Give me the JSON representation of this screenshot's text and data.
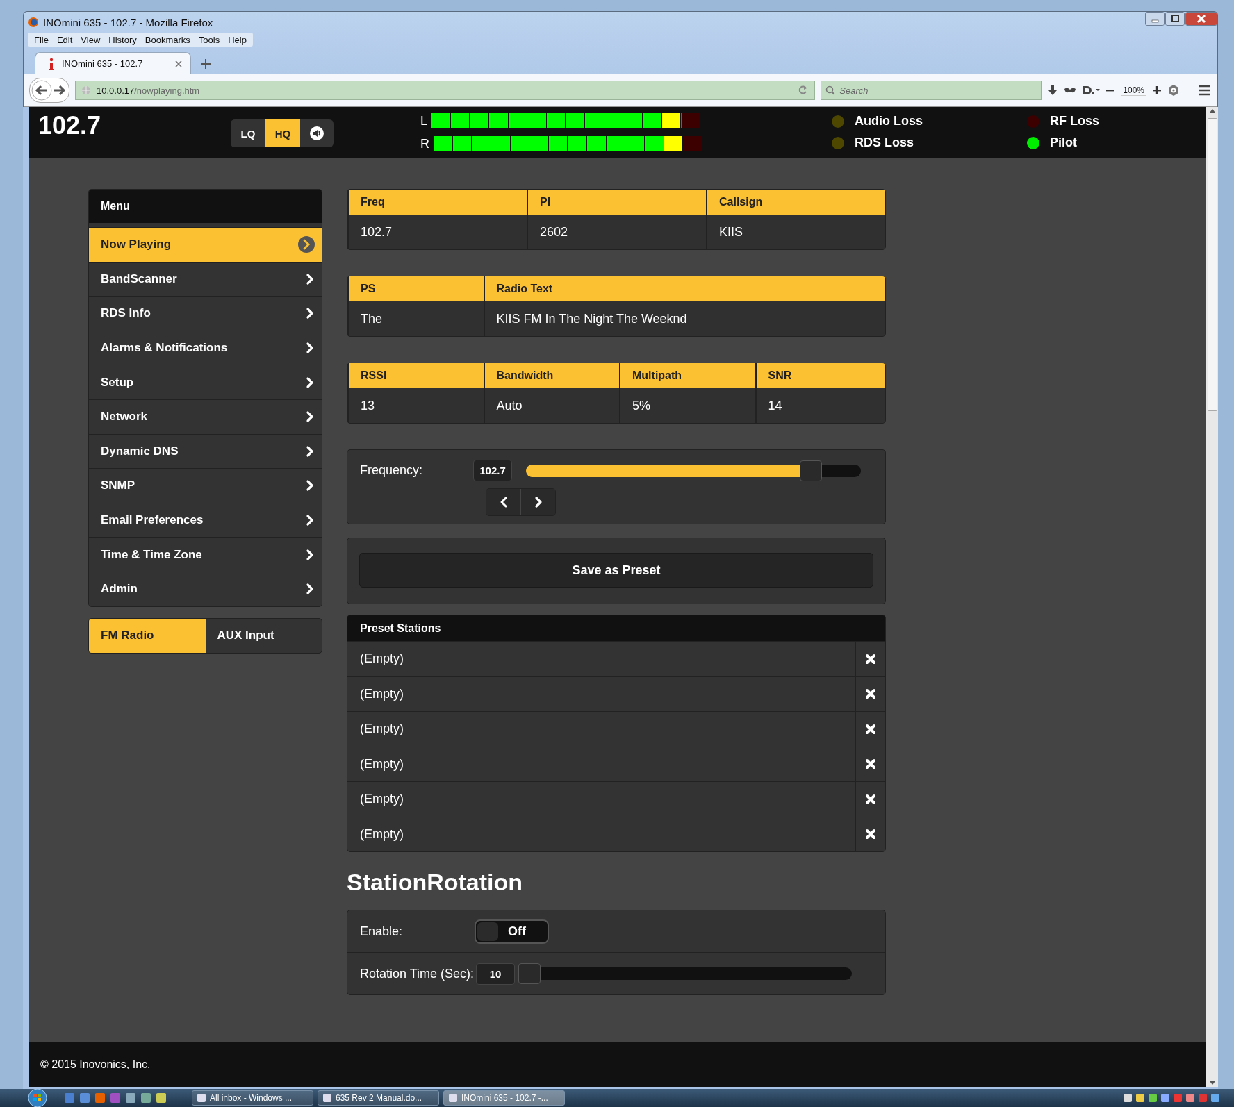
{
  "browser": {
    "title": "INOmini 635 - 102.7 - Mozilla Firefox",
    "menu": [
      "File",
      "Edit",
      "View",
      "History",
      "Bookmarks",
      "Tools",
      "Help"
    ],
    "tab": "INOmini 635 - 102.7",
    "url_host": "10.0.0.17",
    "url_path": "/nowplaying.htm",
    "search": {
      "placeholder": "Search"
    },
    "zoom": "100%"
  },
  "header": {
    "frequency": "102.7",
    "quality": [
      {
        "label": "LQ",
        "selected": false
      },
      {
        "label": "HQ",
        "selected": true
      }
    ],
    "meters": [
      {
        "label": "L",
        "level": 0.929
      },
      {
        "label": "R",
        "level": 0.929
      }
    ],
    "indicators": [
      {
        "label": "Audio Loss",
        "color": "#4d4700"
      },
      {
        "label": "RF Loss",
        "color": "#3d0000"
      },
      {
        "label": "RDS Loss",
        "color": "#4d4700"
      },
      {
        "label": "Pilot",
        "color": "#00ee00"
      }
    ]
  },
  "sidebar": {
    "title": "Menu",
    "items": [
      {
        "label": "Now Playing",
        "selected": true
      },
      {
        "label": "BandScanner",
        "selected": false
      },
      {
        "label": "RDS Info",
        "selected": false
      },
      {
        "label": "Alarms & Notifications",
        "selected": false
      },
      {
        "label": "Setup",
        "selected": false
      },
      {
        "label": "Network",
        "selected": false
      },
      {
        "label": "Dynamic DNS",
        "selected": false
      },
      {
        "label": "SNMP",
        "selected": false
      },
      {
        "label": "Email Preferences",
        "selected": false
      },
      {
        "label": "Time & Time Zone",
        "selected": false
      },
      {
        "label": "Admin",
        "selected": false
      }
    ],
    "sources": [
      {
        "label": "FM Radio",
        "selected": true
      },
      {
        "label": "AUX Input",
        "selected": false
      }
    ]
  },
  "info_panels": [
    [
      {
        "label": "Freq",
        "value": "102.7"
      },
      {
        "label": "PI",
        "value": "2602"
      },
      {
        "label": "Callsign",
        "value": "KIIS"
      }
    ],
    [
      {
        "label": "PS",
        "value": "The"
      },
      {
        "label": "Radio Text",
        "value": "KIIS FM In The Night The Weeknd"
      }
    ],
    [
      {
        "label": "RSSI",
        "value": "13"
      },
      {
        "label": "Bandwidth",
        "value": "Auto"
      },
      {
        "label": "Multipath",
        "value": "5%"
      },
      {
        "label": "SNR",
        "value": "14"
      }
    ]
  ],
  "frequency": {
    "label": "Frequency:",
    "value": "102.7",
    "level": 0.875
  },
  "save_button": "Save as Preset",
  "presets": {
    "title": "Preset Stations",
    "items": [
      "(Empty)",
      "(Empty)",
      "(Empty)",
      "(Empty)",
      "(Empty)",
      "(Empty)"
    ]
  },
  "rotation": {
    "heading": "StationRotation",
    "enable_label": "Enable:",
    "toggle": {
      "label": "Off",
      "on": false
    },
    "time_label": "Rotation Time (Sec):",
    "time_value": "10",
    "level": 0
  },
  "footer": "© 2015 Inovonics, Inc.",
  "taskbar": [
    {
      "label": "All inbox - Windows ...",
      "selected": false
    },
    {
      "label": "635 Rev 2 Manual.do...",
      "selected": false
    },
    {
      "label": "INOmini 635 - 102.7 -...",
      "selected": true
    }
  ]
}
